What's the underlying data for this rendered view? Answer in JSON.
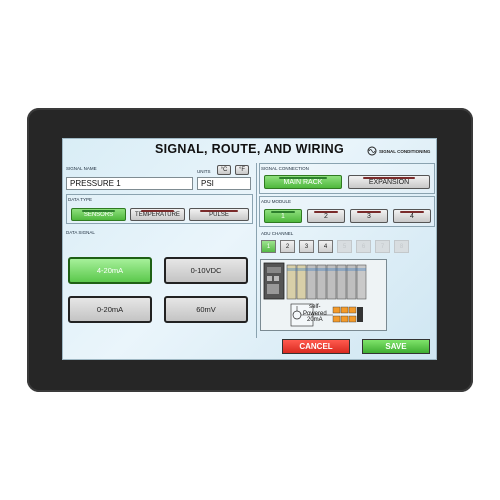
{
  "title": "SIGNAL, ROUTE, AND WIRING",
  "logo_text": "SIGNAL CONDITIONING",
  "signal_name": {
    "label": "SIGNAL NAME",
    "value": "PRESSURE 1"
  },
  "units": {
    "label": "UNITS",
    "value": "PSI",
    "buttons": [
      "°C",
      "°F"
    ]
  },
  "signal_connection": {
    "label": "SIGNAL CONNECTION",
    "buttons": [
      "MAIN RACK",
      "EXPANSION"
    ],
    "selected": "MAIN RACK"
  },
  "data_type": {
    "label": "DATA TYPE",
    "buttons": [
      "SENSORS",
      "TEMPERATURE",
      "PULSE"
    ],
    "selected": "SENSORS"
  },
  "adu_module": {
    "label": "ADU MODULE",
    "buttons": [
      "1",
      "2",
      "3",
      "4"
    ],
    "selected": "1"
  },
  "adu_channel": {
    "label": "ADU CHANNEL",
    "buttons": [
      "1",
      "2",
      "3",
      "4",
      "5",
      "6",
      "7",
      "8"
    ],
    "selected": "1",
    "enabled_count": 4
  },
  "data_signal": {
    "label": "DATA SIGNAL",
    "buttons": [
      "4-20mA",
      "0-10VDC",
      "0-20mA",
      "60mV"
    ],
    "selected": "4-20mA"
  },
  "wiring": {
    "note_line1": "self-",
    "note_line2": "Powered",
    "note_line3": "20mA"
  },
  "actions": {
    "cancel": "CANCEL",
    "save": "SAVE"
  },
  "colors": {
    "selected": "#4fb83d",
    "cancel": "#e8302a",
    "save": "#4fbe3e",
    "bezel": "#262626"
  }
}
